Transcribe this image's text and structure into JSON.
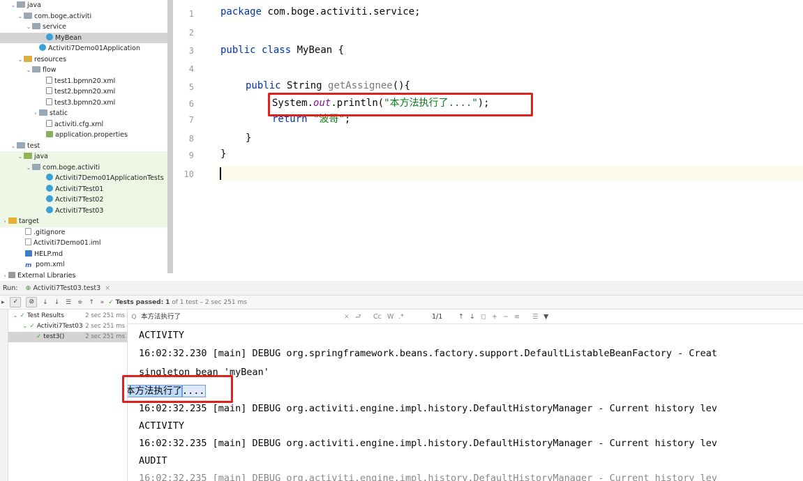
{
  "project_tree": [
    {
      "indent": 14,
      "arrow": "v",
      "icon": "folder",
      "label": "java",
      "green": false,
      "sel": false
    },
    {
      "indent": 24,
      "arrow": "v",
      "icon": "folder",
      "label": "com.boge.activiti",
      "green": false,
      "sel": false
    },
    {
      "indent": 36,
      "arrow": "v",
      "icon": "folder",
      "label": "service",
      "green": false,
      "sel": false
    },
    {
      "indent": 56,
      "arrow": "",
      "icon": "cls",
      "label": "MyBean",
      "green": false,
      "sel": true
    },
    {
      "indent": 46,
      "arrow": "",
      "icon": "cls",
      "label": "Activiti7Demo01Application",
      "green": false,
      "sel": false
    },
    {
      "indent": 24,
      "arrow": "v",
      "icon": "res",
      "label": "resources",
      "green": false,
      "sel": false
    },
    {
      "indent": 36,
      "arrow": "v",
      "icon": "folder",
      "label": "flow",
      "green": false,
      "sel": false
    },
    {
      "indent": 56,
      "arrow": "",
      "icon": "xml",
      "label": "test1.bpmn20.xml",
      "green": false,
      "sel": false
    },
    {
      "indent": 56,
      "arrow": "",
      "icon": "xml",
      "label": "test2.bpmn20.xml",
      "green": false,
      "sel": false
    },
    {
      "indent": 56,
      "arrow": "",
      "icon": "xml",
      "label": "test3.bpmn20.xml",
      "green": false,
      "sel": false
    },
    {
      "indent": 46,
      "arrow": ">",
      "icon": "folder",
      "label": "static",
      "green": false,
      "sel": false
    },
    {
      "indent": 56,
      "arrow": "",
      "icon": "xml",
      "label": "activiti.cfg.xml",
      "green": false,
      "sel": false
    },
    {
      "indent": 56,
      "arrow": "",
      "icon": "prop",
      "label": "application.properties",
      "green": false,
      "sel": false
    },
    {
      "indent": 14,
      "arrow": "v",
      "icon": "folder",
      "label": "test",
      "green": false,
      "sel": false
    },
    {
      "indent": 24,
      "arrow": "v",
      "icon": "folderG",
      "label": "java",
      "green": true,
      "sel": false
    },
    {
      "indent": 36,
      "arrow": "v",
      "icon": "folder",
      "label": "com.boge.activiti",
      "green": true,
      "sel": false
    },
    {
      "indent": 56,
      "arrow": "",
      "icon": "cls",
      "label": "Activiti7Demo01ApplicationTests",
      "green": true,
      "sel": false
    },
    {
      "indent": 56,
      "arrow": "",
      "icon": "cls",
      "label": "Activiti7Test01",
      "green": true,
      "sel": false
    },
    {
      "indent": 56,
      "arrow": "",
      "icon": "cls",
      "label": "Activiti7Test02",
      "green": true,
      "sel": false
    },
    {
      "indent": 56,
      "arrow": "",
      "icon": "cls",
      "label": "Activiti7Test03",
      "green": true,
      "sel": false
    },
    {
      "indent": 2,
      "arrow": ">",
      "icon": "folderY",
      "label": "target",
      "green": true,
      "sel": false
    },
    {
      "indent": 26,
      "arrow": "",
      "icon": "file",
      "label": ".gitignore",
      "green": false,
      "sel": false
    },
    {
      "indent": 26,
      "arrow": "",
      "icon": "file",
      "label": "Activiti7Demo01.iml",
      "green": false,
      "sel": false
    },
    {
      "indent": 26,
      "arrow": "",
      "icon": "md",
      "label": "HELP.md",
      "green": false,
      "sel": false
    },
    {
      "indent": 26,
      "arrow": "",
      "icon": "mvn",
      "label": "pom.xml",
      "green": false,
      "sel": false
    },
    {
      "indent": 2,
      "arrow": ">",
      "icon": "lib",
      "label": "External Libraries",
      "green": false,
      "sel": false
    }
  ],
  "line_numbers": [
    "1",
    "2",
    "3",
    "4",
    "5",
    "6",
    "7",
    "8",
    "9",
    "10"
  ],
  "code": {
    "l1_kw": "package",
    "l1_rest": " com.boge.activiti.service;",
    "l3_kw1": "public",
    "l3_kw2": "class",
    "l3_rest": " MyBean {",
    "l5_kw": "public",
    "l5_type": " String ",
    "l5_fn": "getAssignee",
    "l5_rest": "(){",
    "l6_a": "System.",
    "l6_out": "out",
    "l6_b": ".println(",
    "l6_str": "\"本方法执行了....\"",
    "l6_c": ");",
    "l7_kw": "return",
    "l7_str": "\"波哥\"",
    "l7_c": ";",
    "l8": "}",
    "l9": "}"
  },
  "run": {
    "label": "Run:",
    "tab": "Activiti7Test03.test3",
    "status": "Tests passed:",
    "count": "1",
    "detail": "of 1 test – 2 sec 251 ms"
  },
  "tests": [
    {
      "indent": 6,
      "label": "Test Results",
      "duration": "2 sec 251 ms",
      "sel": false
    },
    {
      "indent": 20,
      "label": "Activiti7Test03",
      "duration": "2 sec 251 ms",
      "sel": false
    },
    {
      "indent": 40,
      "label": "test3()",
      "duration": "2 sec 251 ms",
      "sel": true
    }
  ],
  "search": {
    "query": "本方法执行了",
    "cc": "Cc",
    "w": "W",
    "regex": ".*",
    "match": "1/1"
  },
  "console": {
    "c1": "ACTIVITY",
    "c2": "16:02:32.230 [main] DEBUG org.springframework.beans.factory.support.DefaultListableBeanFactory - Creat",
    "c3": "singleton bean 'myBean'",
    "c4_hl": "本方法执行了",
    "c4_rest": "....",
    "c5": "16:02:32.235 [main] DEBUG org.activiti.engine.impl.history.DefaultHistoryManager - Current history lev",
    "c6": "ACTIVITY",
    "c7": "16:02:32.235 [main] DEBUG org.activiti.engine.impl.history.DefaultHistoryManager - Current history lev",
    "c8": "AUDIT",
    "c9": "16:02:32.235 [main] DEBUG org.activiti.engine.impl.history.DefaultHistoryManager - Current history lev"
  },
  "colors": {
    "highlight_box": "#e0201b",
    "pass_green": "#44a044"
  }
}
